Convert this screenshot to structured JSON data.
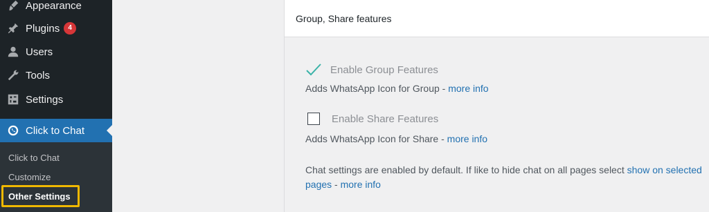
{
  "sidebar": {
    "items": [
      {
        "label": "Appearance",
        "icon": "paintbrush-icon"
      },
      {
        "label": "Plugins",
        "icon": "plugin-icon",
        "badge": "4"
      },
      {
        "label": "Users",
        "icon": "user-icon"
      },
      {
        "label": "Tools",
        "icon": "wrench-icon"
      },
      {
        "label": "Settings",
        "icon": "settings-icon"
      }
    ],
    "active": {
      "label": "Click to Chat",
      "icon": "whatsapp-icon"
    },
    "submenu": [
      {
        "label": "Click to Chat"
      },
      {
        "label": "Customize"
      },
      {
        "label": "Other Settings"
      }
    ],
    "colors": {
      "background": "#1d2327",
      "active": "#2271b1",
      "highlight": "#f0b800",
      "badge": "#d63638"
    }
  },
  "panel": {
    "title": "Group, Share features",
    "options": [
      {
        "label": "Enable Group Features",
        "checked": true,
        "desc_text": "Adds WhatsApp Icon for Group - ",
        "desc_link": "more info"
      },
      {
        "label": "Enable Share Features",
        "checked": false,
        "desc_text": "Adds WhatsApp Icon for Share - ",
        "desc_link": "more info"
      }
    ],
    "note": {
      "text1": "Chat settings are enabled by default. If like to hide chat on all pages select ",
      "link1": "show on selected",
      "link1_cont": "pages",
      "sep": " - ",
      "link2": "more info"
    },
    "colors": {
      "link": "#2271b1",
      "check": "#3bb3a8"
    }
  }
}
